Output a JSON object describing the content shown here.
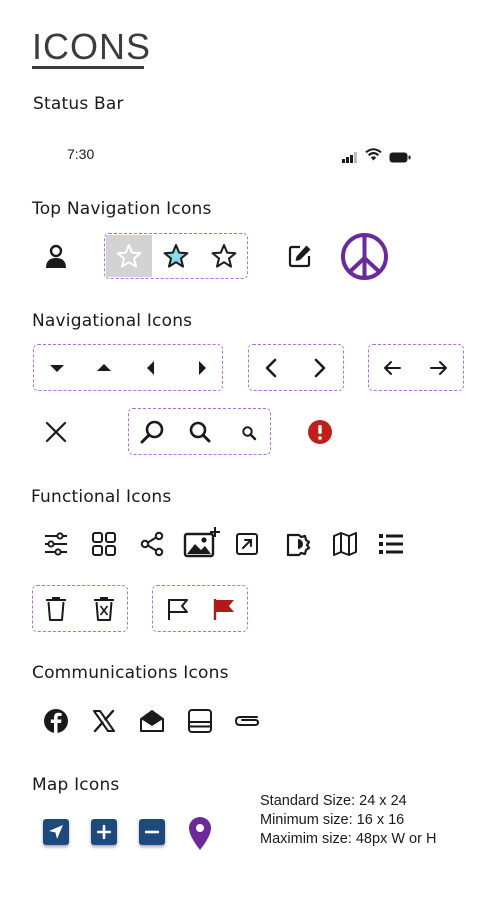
{
  "title": "ICONS",
  "sections": {
    "status_bar": "Status Bar",
    "top_navigation": "Top Navigation Icons",
    "navigational": "Navigational Icons",
    "functional": "Functional Icons",
    "communications": "Communications Icons",
    "map": "Map Icons"
  },
  "status_bar": {
    "time": "7:30"
  },
  "colors": {
    "dashed_border": "#b46ce0",
    "peace_purple": "#6a2a9a",
    "alert_red": "#c0201c",
    "flag_red": "#b01a1a",
    "map_blue": "#1d4a7a",
    "star_fill": "#8ad8ea",
    "star_bg": "#d3d3d3"
  },
  "size_info": [
    "Standard Size: 24 x 24",
    "Minimum size: 16 x 16",
    "Maximim size: 48px W or H"
  ]
}
